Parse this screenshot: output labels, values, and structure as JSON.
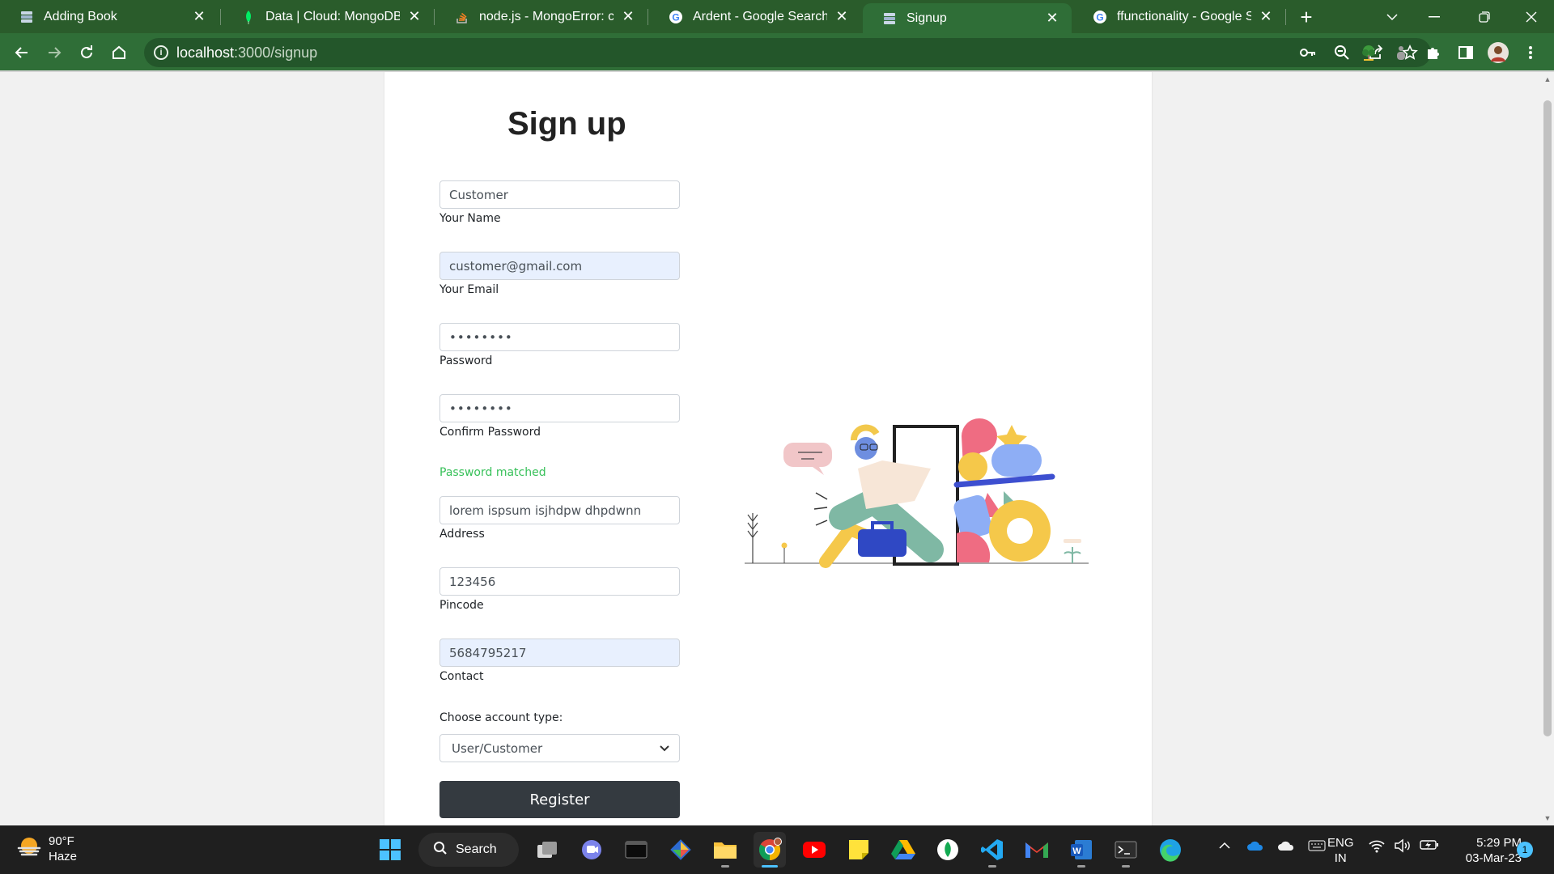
{
  "browser": {
    "tabs": [
      {
        "title": "Adding Book",
        "favicon": "stack-page-icon",
        "active": false
      },
      {
        "title": "Data | Cloud: MongoDB Clo",
        "favicon": "mongodb-leaf-icon",
        "active": false
      },
      {
        "title": "node.js - MongoError: conn",
        "favicon": "stackoverflow-icon",
        "active": false
      },
      {
        "title": "Ardent - Google Search",
        "favicon": "google-icon",
        "active": false
      },
      {
        "title": "Signup",
        "favicon": "stack-page-icon",
        "active": true
      },
      {
        "title": "ffunctionality - Google Sear",
        "favicon": "google-icon",
        "active": false
      }
    ],
    "url_host": "localhost",
    "url_path": ":3000/signup"
  },
  "page": {
    "heading": "Sign up",
    "fields": {
      "name": {
        "value": "Customer",
        "label": "Your Name"
      },
      "email": {
        "value": "customer@gmail.com",
        "label": "Your Email"
      },
      "password": {
        "value": "password",
        "label": "Password"
      },
      "confirm": {
        "value": "password",
        "label": "Confirm Password"
      },
      "address": {
        "value": "lorem ispsum isjhdpw dhpdwnn",
        "label": "Address"
      },
      "pincode": {
        "value": "123456",
        "label": "Pincode"
      },
      "contact": {
        "value": "5684795217",
        "label": "Contact"
      }
    },
    "password_status": "Password matched",
    "account_type_label": "Choose account type:",
    "account_type_value": "User/Customer",
    "register_label": "Register"
  },
  "taskbar": {
    "temperature": "90°F",
    "weather": "Haze",
    "search_label": "Search",
    "lang_top": "ENG",
    "lang_bottom": "IN",
    "time": "5:29 PM",
    "date": "03-Mar-23",
    "notification_count": "1"
  },
  "colors": {
    "tabstrip": "#2a5c2b",
    "toolbar": "#2f6e37",
    "success": "#38c15a",
    "register_button": "#343a40"
  }
}
